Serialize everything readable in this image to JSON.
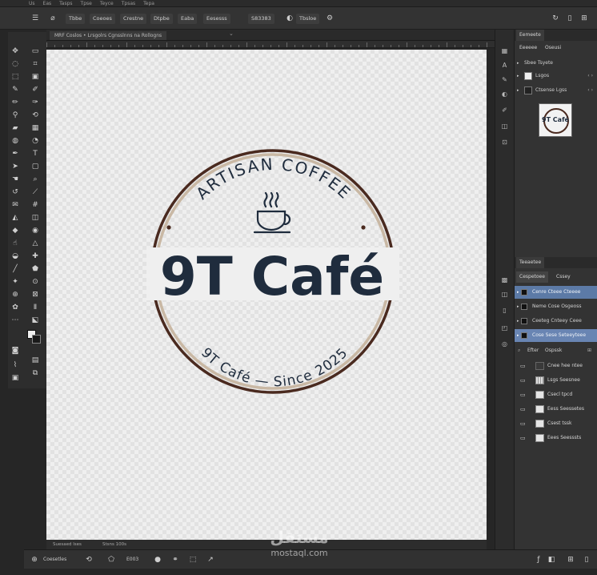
{
  "menubar": {
    "items": [
      "Us",
      "Eas",
      "Tasps",
      "Tpse",
      "Teyce",
      "Tpsas",
      "Tepa"
    ]
  },
  "optionsbar": {
    "items": [
      "Tbbe",
      "Coeoes",
      "Crestne",
      "Dtpbe",
      "Eaba",
      "Eesesss",
      "S83383",
      "Tbsloe"
    ]
  },
  "document": {
    "tab_label": "MRF Coslos • Lrsgolrs Cgnsslnns na Rollogns"
  },
  "logo": {
    "top_text": "ARTISAN COFFEE",
    "name": "9T Café",
    "bottom_text": "9T Café — Since 2025",
    "colors": {
      "ring_dark": "#4a2a1f",
      "ring_light": "#c9b8a4",
      "text_dark": "#1f2c3d"
    }
  },
  "statusbar": {
    "left": "Suesaed lses",
    "right": "Stsns 100s"
  },
  "bottombar": {
    "label1": "Coesetles",
    "label2": "E003"
  },
  "panel_top": {
    "tabs": [
      "Eemeete",
      "Eeeeee",
      "Oseusi"
    ],
    "section": "Sbee Tsyete",
    "rows": [
      "Lsgos",
      "Ctsense Lgss"
    ],
    "thumb_text": "9T Café"
  },
  "panel_bottom": {
    "header": "Teeaetee",
    "tabs": [
      "Cespetoee",
      "Cssey"
    ],
    "groups": [
      "Cenre Cteee Cteeee",
      "Neme Cose Osgeoss",
      "Ceeteg Cnteey Ceee",
      "Cose Sese Seteeyteee"
    ],
    "subtabs": [
      "Efter",
      "Ospssk"
    ],
    "layers": [
      "Cnee hee ntee",
      "Lsgs Seesnee",
      "Csecl tpcd",
      "Eess Seessetes",
      "Csest tssk",
      "Eees Seesssts"
    ]
  },
  "watermark": {
    "arabic": "مستقل",
    "latin": "mostaql.com"
  }
}
